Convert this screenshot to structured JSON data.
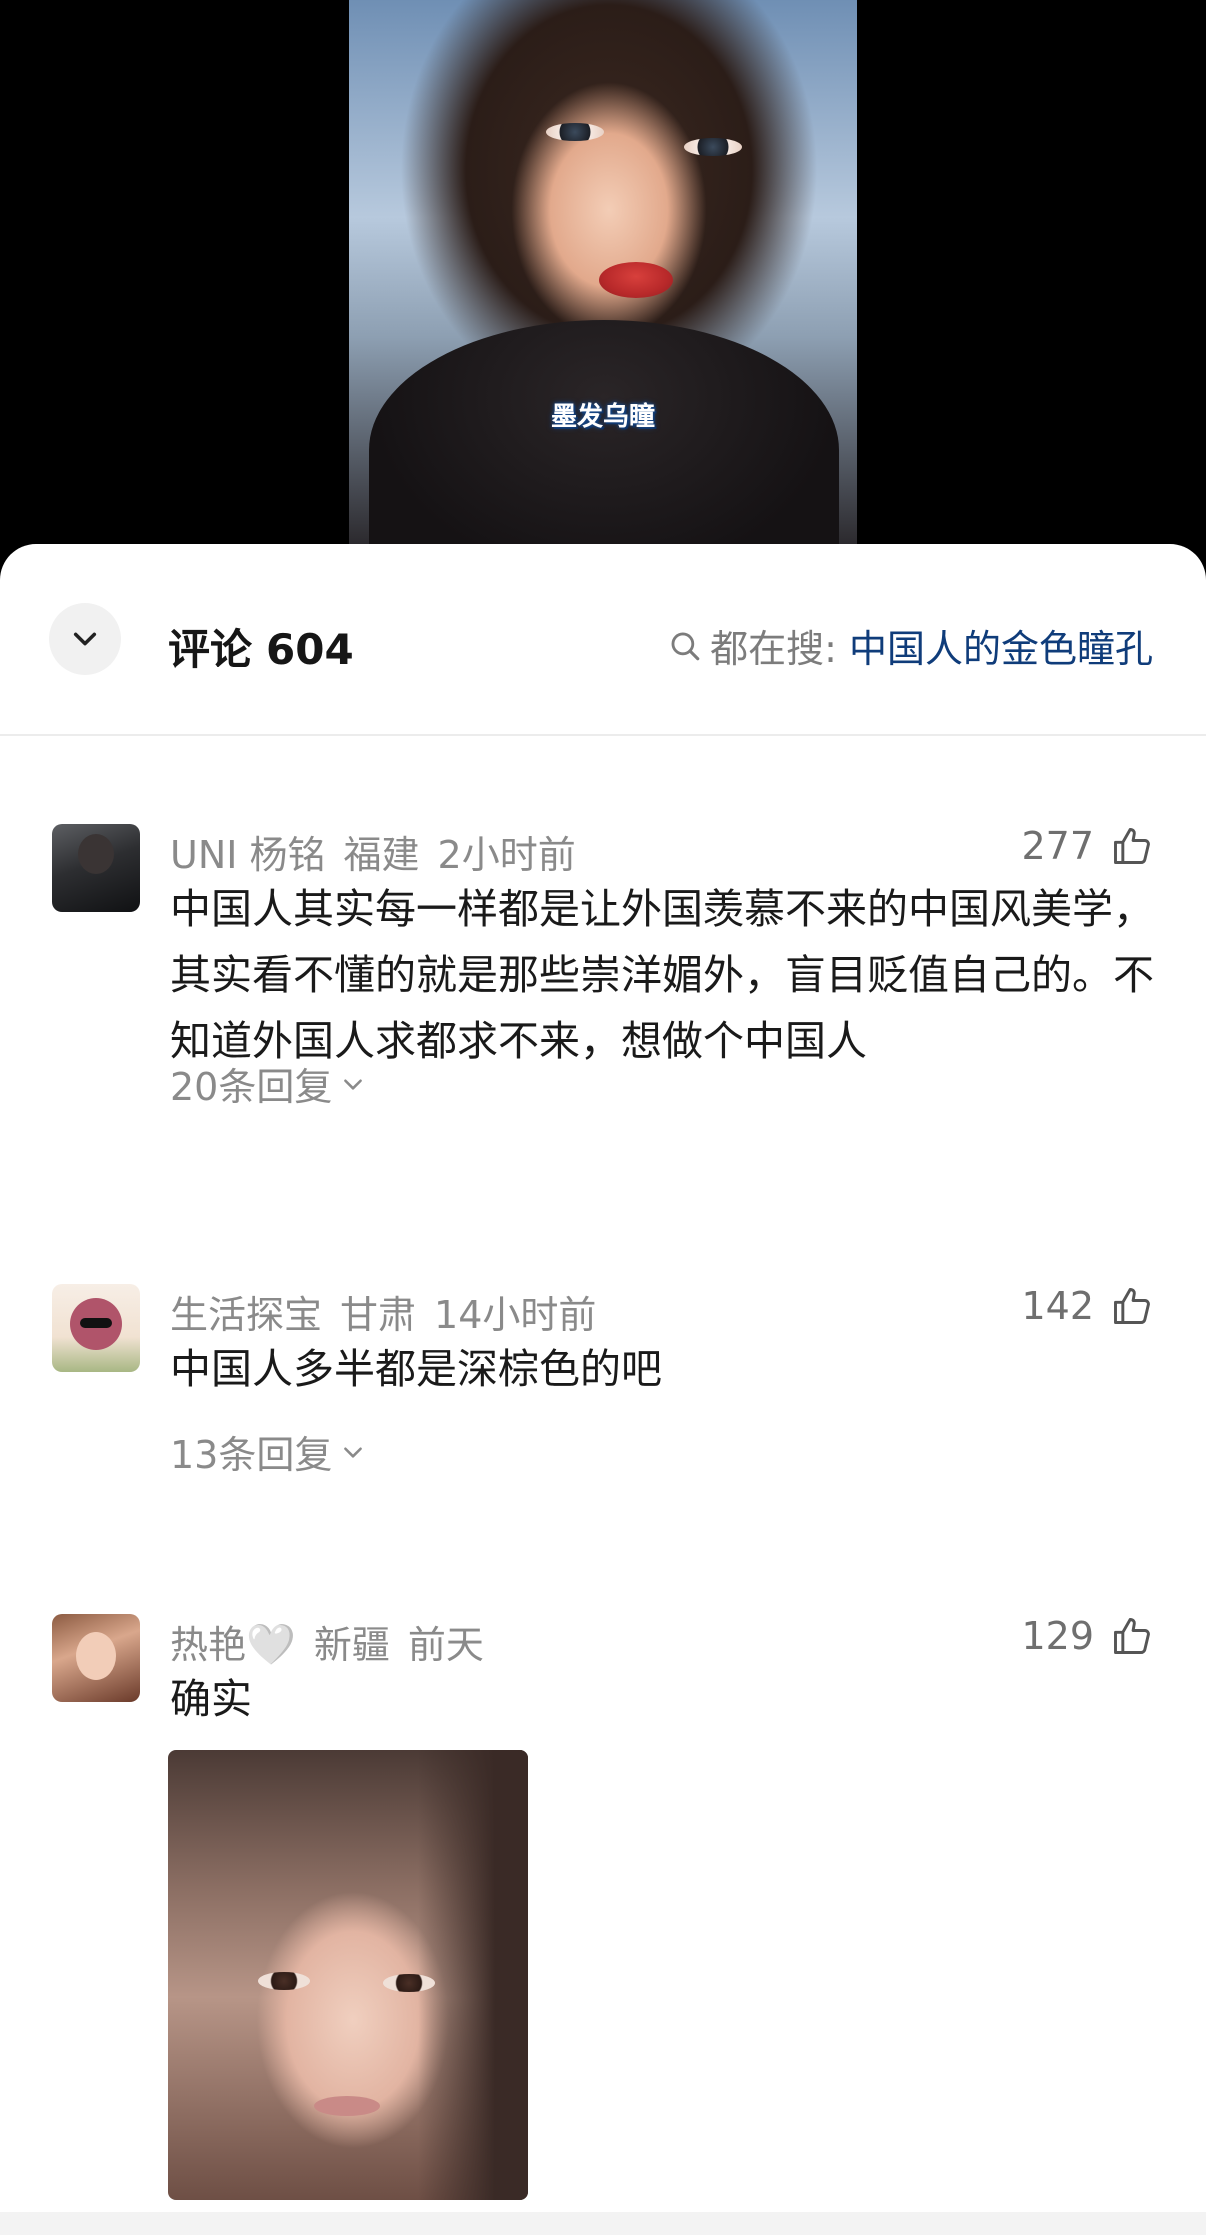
{
  "video": {
    "caption": "墨发乌瞳"
  },
  "header": {
    "title": "评论",
    "count": "604",
    "search_prefix": "都在搜:",
    "search_keyword": "中国人的金色瞳孔"
  },
  "comments": [
    {
      "username": "UNI 杨铭",
      "location": "福建",
      "time": "2小时前",
      "likes": "277",
      "text": "中国人其实每一样都是让外国羡慕不来的中国风美学，其实看不懂的就是那些崇洋媚外，盲目贬值自己的。不知道外国人求都求不来，想做个中国人",
      "replies": "20条回复"
    },
    {
      "username": "生活探宝",
      "location": "甘肃",
      "time": "14小时前",
      "likes": "142",
      "text": "中国人多半都是深棕色的吧",
      "replies": "13条回复"
    },
    {
      "username": "热艳",
      "username_emoji": "🤍",
      "location": "新疆",
      "time": "前天",
      "likes": "129",
      "text": "确实"
    }
  ],
  "colors": {
    "keyword": "#0f3c7a",
    "meta": "#8a8a8a",
    "text": "#1a1a1a"
  }
}
